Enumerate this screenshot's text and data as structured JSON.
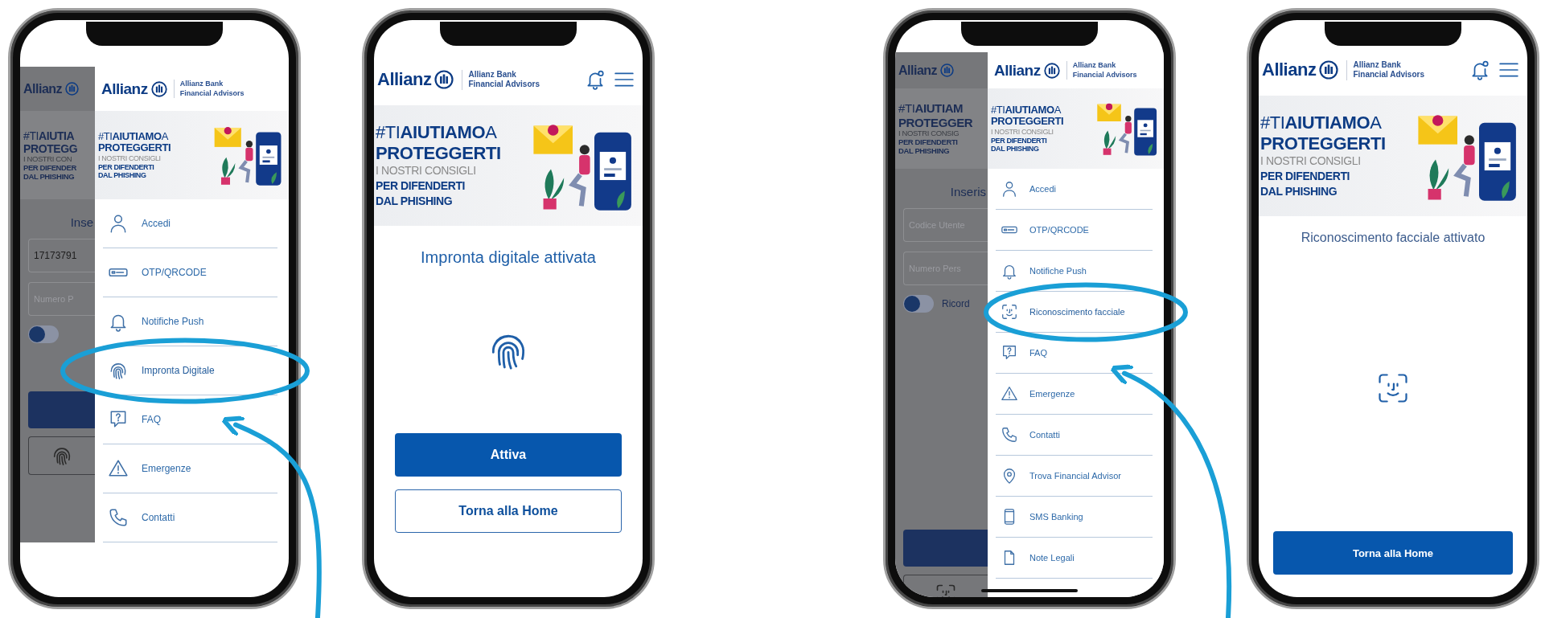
{
  "phones": [
    {
      "kind": "menu",
      "background": {
        "brand": "Allianz",
        "banner": [
          {
            "kind": "headline",
            "text": "#TI**AIUTIA**"
          },
          {
            "kind": "headline-bold",
            "text": "PROTEGG"
          },
          {
            "kind": "muted",
            "text": "I NOSTRI CON"
          },
          {
            "kind": "emphasis",
            "text": "PER DIFENDER"
          },
          {
            "kind": "emphasis",
            "text": "DAL PHISHING"
          }
        ],
        "prompt": "Inse",
        "fields": [
          {
            "value": "17173791"
          },
          {
            "placeholder": "Numero P"
          }
        ],
        "toggle": {
          "on": false
        },
        "buttons": [
          {
            "kind": "primary"
          },
          {
            "kind": "fingerprint"
          }
        ]
      },
      "menu": {
        "brand": "Allianz",
        "subbrand": [
          "Allianz Bank",
          "Financial Advisors"
        ],
        "banner": [
          {
            "kind": "headline",
            "text": "#TI**AIUTIAMO**A"
          },
          {
            "kind": "headline-bold",
            "text": "PROTEGGERTI"
          },
          {
            "kind": "muted",
            "text": "I NOSTRI CONSIGLI"
          },
          {
            "kind": "emphasis",
            "text": "PER DIFENDERTI"
          },
          {
            "kind": "emphasis",
            "text": "DAL PHISHING"
          }
        ],
        "items": [
          {
            "kind": "person",
            "label": "Accedi",
            "highlighted": false
          },
          {
            "kind": "card",
            "label": "OTP/QRCODE",
            "highlighted": false
          },
          {
            "kind": "bell",
            "label": "Notifiche Push",
            "highlighted": false
          },
          {
            "kind": "fingerprint",
            "label": "Impronta Digitale",
            "highlighted": true
          },
          {
            "kind": "question",
            "label": "FAQ",
            "highlighted": false
          },
          {
            "kind": "warning",
            "label": "Emergenze",
            "highlighted": false
          },
          {
            "kind": "handset",
            "label": "Contatti",
            "highlighted": false
          }
        ]
      }
    },
    {
      "kind": "result",
      "header": {
        "brand": "Allianz",
        "subbrand": [
          "Allianz Bank",
          "Financial Advisors"
        ]
      },
      "banner": [
        {
          "kind": "headline",
          "text": "#TI**AIUTIAMO**A"
        },
        {
          "kind": "headline-bold",
          "text": "PROTEGGERTI"
        },
        {
          "kind": "muted",
          "text": "I NOSTRI CONSIGLI"
        },
        {
          "kind": "emphasis",
          "text": "PER DIFENDERTI"
        },
        {
          "kind": "emphasis",
          "text": "DAL PHISHING"
        }
      ],
      "title": "Impronta digitale attivata",
      "status": {
        "kind": "fingerprint"
      },
      "buttons": [
        {
          "kind": "primary",
          "label": "Attiva"
        },
        {
          "kind": "outline",
          "label": "Torna alla Home"
        }
      ]
    },
    {
      "kind": "menu",
      "home_indicator": true,
      "background": {
        "brand": "Allianz",
        "banner": [
          {
            "kind": "headline",
            "text": "#TI**AIUTIAM**"
          },
          {
            "kind": "headline-bold",
            "text": "PROTEGGER"
          },
          {
            "kind": "muted",
            "text": "I NOSTRI CONSIG"
          },
          {
            "kind": "emphasis",
            "text": "PER DIFENDERTI"
          },
          {
            "kind": "emphasis",
            "text": "DAL PHISHING"
          }
        ],
        "prompt": "Inseris",
        "fields": [
          {
            "placeholder": "Codice Utente"
          },
          {
            "placeholder": "Numero Pers"
          }
        ],
        "toggle": {
          "on": false,
          "label": "Ricord"
        },
        "buttons": [
          {
            "kind": "primary"
          },
          {
            "kind": "face"
          }
        ]
      },
      "menu": {
        "brand": "Allianz",
        "subbrand": [
          "Allianz Bank",
          "Financial Advisors"
        ],
        "banner": [
          {
            "kind": "headline",
            "text": "#TI**AIUTIAMO**A"
          },
          {
            "kind": "headline-bold",
            "text": "PROTEGGERTI"
          },
          {
            "kind": "muted",
            "text": "I NOSTRI CONSIGLI"
          },
          {
            "kind": "emphasis",
            "text": "PER DIFENDERTI"
          },
          {
            "kind": "emphasis",
            "text": "DAL PHISHING"
          }
        ],
        "items": [
          {
            "kind": "person",
            "label": "Accedi",
            "highlighted": false
          },
          {
            "kind": "card",
            "label": "OTP/QRCODE",
            "highlighted": false
          },
          {
            "kind": "bell",
            "label": "Notifiche Push",
            "highlighted": false
          },
          {
            "kind": "face",
            "label": "Riconoscimento facciale",
            "highlighted": true
          },
          {
            "kind": "question",
            "label": "FAQ",
            "highlighted": false
          },
          {
            "kind": "warning",
            "label": "Emergenze",
            "highlighted": false
          },
          {
            "kind": "handset",
            "label": "Contatti",
            "highlighted": false
          },
          {
            "kind": "pin",
            "label": "Trova Financial Advisor",
            "highlighted": false
          },
          {
            "kind": "mobile",
            "label": "SMS Banking",
            "highlighted": false
          },
          {
            "kind": "document",
            "label": "Note Legali",
            "highlighted": false
          }
        ]
      }
    },
    {
      "kind": "result",
      "header": {
        "brand": "Allianz",
        "subbrand": [
          "Allianz Bank",
          "Financial Advisors"
        ]
      },
      "banner": [
        {
          "kind": "headline",
          "text": "#TI**AIUTIAMO**A"
        },
        {
          "kind": "headline-bold",
          "text": "PROTEGGERTI"
        },
        {
          "kind": "muted",
          "text": "I NOSTRI CONSIGLI"
        },
        {
          "kind": "emphasis",
          "text": "PER DIFENDERTI"
        },
        {
          "kind": "emphasis",
          "text": "DAL PHISHING"
        }
      ],
      "title": "Riconoscimento facciale attivato",
      "status": {
        "kind": "face"
      },
      "buttons": [
        {
          "kind": "primary",
          "label": "Torna alla Home"
        }
      ]
    }
  ]
}
